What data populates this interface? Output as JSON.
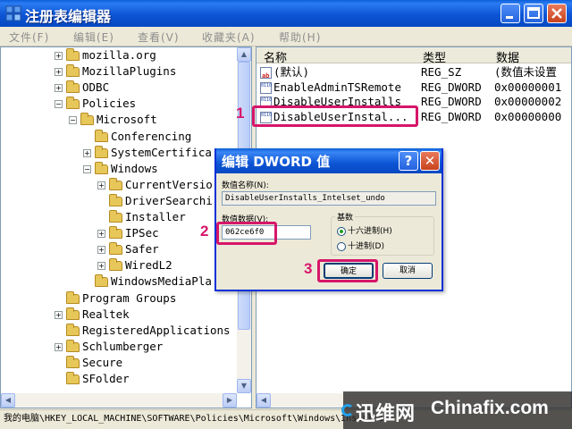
{
  "window": {
    "title": "注册表编辑器",
    "controls": {
      "min": "_",
      "max": "□",
      "close": "✕"
    }
  },
  "menu": [
    {
      "label": "文件(F)"
    },
    {
      "label": "编辑(E)"
    },
    {
      "label": "查看(V)"
    },
    {
      "label": "收藏夹(A)"
    },
    {
      "label": "帮助(H)"
    }
  ],
  "tree": {
    "items": [
      {
        "label": "mozilla.org",
        "expander": "+"
      },
      {
        "label": "MozillaPlugins",
        "expander": "+"
      },
      {
        "label": "ODBC",
        "expander": "+"
      },
      {
        "label": "Policies",
        "expander": "−"
      },
      {
        "label": "Microsoft",
        "expander": "−"
      },
      {
        "label": "Conferencing",
        "expander": ""
      },
      {
        "label": "SystemCertifica",
        "expander": "+"
      },
      {
        "label": "Windows",
        "expander": "−"
      },
      {
        "label": "CurrentVersio",
        "expander": "+"
      },
      {
        "label": "DriverSearchi",
        "expander": ""
      },
      {
        "label": "Installer",
        "expander": ""
      },
      {
        "label": "IPSec",
        "expander": "+"
      },
      {
        "label": "Safer",
        "expander": "+"
      },
      {
        "label": "WiredL2",
        "expander": "+"
      },
      {
        "label": "WindowsMediaPla",
        "expander": ""
      },
      {
        "label": "Program Groups",
        "expander": ""
      },
      {
        "label": "Realtek",
        "expander": "+"
      },
      {
        "label": "RegisteredApplications",
        "expander": ""
      },
      {
        "label": "Schlumberger",
        "expander": "+"
      },
      {
        "label": "Secure",
        "expander": ""
      },
      {
        "label": "SFolder",
        "expander": ""
      }
    ]
  },
  "list": {
    "headers": {
      "name": "名称",
      "type": "类型",
      "data": "数据"
    },
    "rows": [
      {
        "name": "(默认)",
        "type": "REG_SZ",
        "data": "(数值未设置",
        "icon": "string-value-icon"
      },
      {
        "name": "EnableAdminTSRemote",
        "type": "REG_DWORD",
        "data": "0x00000001",
        "icon": "dword-value-icon"
      },
      {
        "name": "DisableUserInstalls",
        "type": "REG_DWORD",
        "data": "0x00000002",
        "icon": "dword-value-icon"
      },
      {
        "name": "DisableUserInstal...",
        "type": "REG_DWORD",
        "data": "0x00000000",
        "icon": "dword-value-icon"
      }
    ]
  },
  "statusbar": {
    "path": "我的电脑\\HKEY_LOCAL_MACHINE\\SOFTWARE\\Policies\\Microsoft\\Windows\\Installer"
  },
  "dialog": {
    "title": "编辑 DWORD 值",
    "help": "?",
    "close": "✕",
    "name_label": "数值名称(N):",
    "name_value": "DisableUserInstalls_Intelset_undo",
    "data_label": "数值数据(V):",
    "data_value": "062ce6f0",
    "base_label": "基数",
    "radio_hex": "十六进制(H)",
    "radio_dec": "十进制(D)",
    "ok": "确定",
    "cancel": "取消"
  },
  "callouts": {
    "one": "1",
    "two": "2",
    "three": "3"
  },
  "watermark": {
    "logo_cn": "迅维网",
    "logo_en": "Chinafix.com"
  },
  "colors": {
    "highlight": "#d6166a",
    "titlebar": "#0d55d5",
    "dialog_border": "#0831d9"
  }
}
